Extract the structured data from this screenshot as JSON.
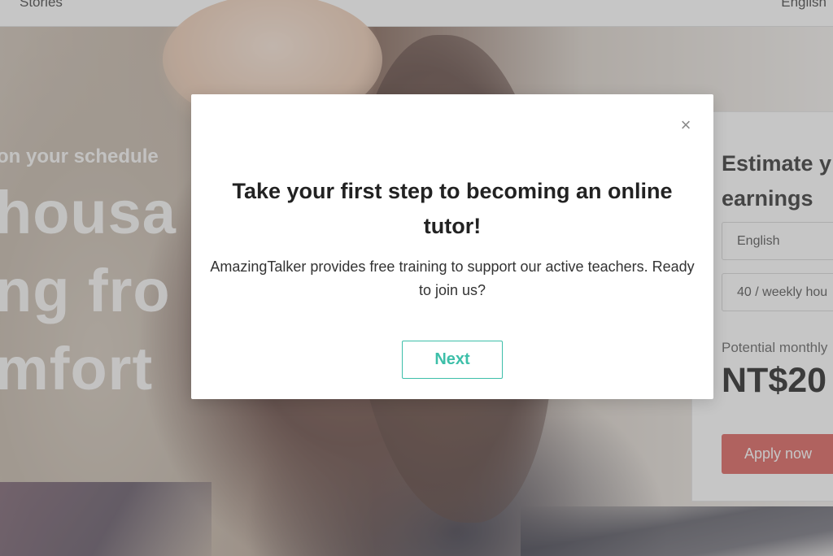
{
  "nav": {
    "left_link": "Stories",
    "right_link": "English"
  },
  "hero": {
    "tagline": "on your schedule",
    "line1": "housa",
    "line2": "ng fro",
    "line3": "mfort"
  },
  "estimate": {
    "title": "Estimate y",
    "title_line2": "earnings",
    "language_select": "English",
    "hours_select": "40 / weekly hou",
    "potential_label": "Potential monthly",
    "potential_value": "NT$20",
    "apply_label": "Apply now"
  },
  "modal": {
    "close_symbol": "×",
    "title": "Take your first step to becoming an online tutor!",
    "body": "AmazingTalker provides free training to support our active teachers. Ready to join us?",
    "next_label": "Next"
  },
  "colors": {
    "accent": "#3dbfa9",
    "apply_red": "#d9534f",
    "overlay": "rgba(120,120,120,0.42)"
  }
}
